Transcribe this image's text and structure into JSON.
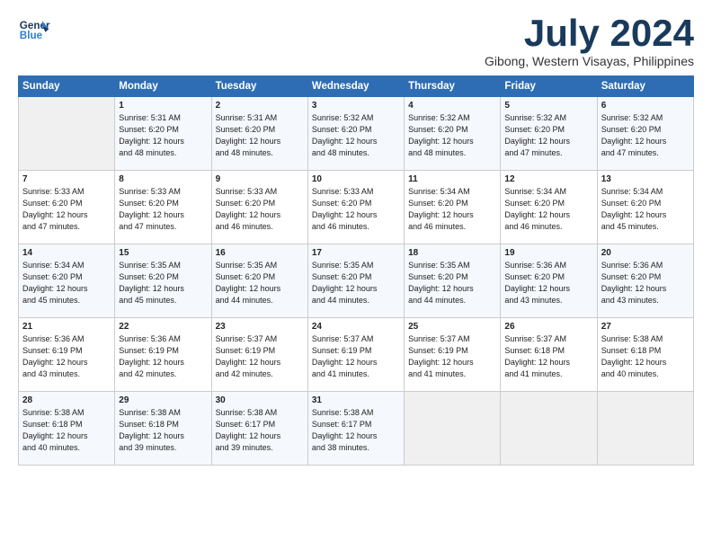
{
  "logo": {
    "line1": "General",
    "line2": "Blue"
  },
  "title": "July 2024",
  "subtitle": "Gibong, Western Visayas, Philippines",
  "days_of_week": [
    "Sunday",
    "Monday",
    "Tuesday",
    "Wednesday",
    "Thursday",
    "Friday",
    "Saturday"
  ],
  "weeks": [
    [
      {
        "day": "",
        "info": ""
      },
      {
        "day": "1",
        "info": "Sunrise: 5:31 AM\nSunset: 6:20 PM\nDaylight: 12 hours\nand 48 minutes."
      },
      {
        "day": "2",
        "info": "Sunrise: 5:31 AM\nSunset: 6:20 PM\nDaylight: 12 hours\nand 48 minutes."
      },
      {
        "day": "3",
        "info": "Sunrise: 5:32 AM\nSunset: 6:20 PM\nDaylight: 12 hours\nand 48 minutes."
      },
      {
        "day": "4",
        "info": "Sunrise: 5:32 AM\nSunset: 6:20 PM\nDaylight: 12 hours\nand 48 minutes."
      },
      {
        "day": "5",
        "info": "Sunrise: 5:32 AM\nSunset: 6:20 PM\nDaylight: 12 hours\nand 47 minutes."
      },
      {
        "day": "6",
        "info": "Sunrise: 5:32 AM\nSunset: 6:20 PM\nDaylight: 12 hours\nand 47 minutes."
      }
    ],
    [
      {
        "day": "7",
        "info": "Sunrise: 5:33 AM\nSunset: 6:20 PM\nDaylight: 12 hours\nand 47 minutes."
      },
      {
        "day": "8",
        "info": "Sunrise: 5:33 AM\nSunset: 6:20 PM\nDaylight: 12 hours\nand 47 minutes."
      },
      {
        "day": "9",
        "info": "Sunrise: 5:33 AM\nSunset: 6:20 PM\nDaylight: 12 hours\nand 46 minutes."
      },
      {
        "day": "10",
        "info": "Sunrise: 5:33 AM\nSunset: 6:20 PM\nDaylight: 12 hours\nand 46 minutes."
      },
      {
        "day": "11",
        "info": "Sunrise: 5:34 AM\nSunset: 6:20 PM\nDaylight: 12 hours\nand 46 minutes."
      },
      {
        "day": "12",
        "info": "Sunrise: 5:34 AM\nSunset: 6:20 PM\nDaylight: 12 hours\nand 46 minutes."
      },
      {
        "day": "13",
        "info": "Sunrise: 5:34 AM\nSunset: 6:20 PM\nDaylight: 12 hours\nand 45 minutes."
      }
    ],
    [
      {
        "day": "14",
        "info": "Sunrise: 5:34 AM\nSunset: 6:20 PM\nDaylight: 12 hours\nand 45 minutes."
      },
      {
        "day": "15",
        "info": "Sunrise: 5:35 AM\nSunset: 6:20 PM\nDaylight: 12 hours\nand 45 minutes."
      },
      {
        "day": "16",
        "info": "Sunrise: 5:35 AM\nSunset: 6:20 PM\nDaylight: 12 hours\nand 44 minutes."
      },
      {
        "day": "17",
        "info": "Sunrise: 5:35 AM\nSunset: 6:20 PM\nDaylight: 12 hours\nand 44 minutes."
      },
      {
        "day": "18",
        "info": "Sunrise: 5:35 AM\nSunset: 6:20 PM\nDaylight: 12 hours\nand 44 minutes."
      },
      {
        "day": "19",
        "info": "Sunrise: 5:36 AM\nSunset: 6:20 PM\nDaylight: 12 hours\nand 43 minutes."
      },
      {
        "day": "20",
        "info": "Sunrise: 5:36 AM\nSunset: 6:20 PM\nDaylight: 12 hours\nand 43 minutes."
      }
    ],
    [
      {
        "day": "21",
        "info": "Sunrise: 5:36 AM\nSunset: 6:19 PM\nDaylight: 12 hours\nand 43 minutes."
      },
      {
        "day": "22",
        "info": "Sunrise: 5:36 AM\nSunset: 6:19 PM\nDaylight: 12 hours\nand 42 minutes."
      },
      {
        "day": "23",
        "info": "Sunrise: 5:37 AM\nSunset: 6:19 PM\nDaylight: 12 hours\nand 42 minutes."
      },
      {
        "day": "24",
        "info": "Sunrise: 5:37 AM\nSunset: 6:19 PM\nDaylight: 12 hours\nand 41 minutes."
      },
      {
        "day": "25",
        "info": "Sunrise: 5:37 AM\nSunset: 6:19 PM\nDaylight: 12 hours\nand 41 minutes."
      },
      {
        "day": "26",
        "info": "Sunrise: 5:37 AM\nSunset: 6:18 PM\nDaylight: 12 hours\nand 41 minutes."
      },
      {
        "day": "27",
        "info": "Sunrise: 5:38 AM\nSunset: 6:18 PM\nDaylight: 12 hours\nand 40 minutes."
      }
    ],
    [
      {
        "day": "28",
        "info": "Sunrise: 5:38 AM\nSunset: 6:18 PM\nDaylight: 12 hours\nand 40 minutes."
      },
      {
        "day": "29",
        "info": "Sunrise: 5:38 AM\nSunset: 6:18 PM\nDaylight: 12 hours\nand 39 minutes."
      },
      {
        "day": "30",
        "info": "Sunrise: 5:38 AM\nSunset: 6:17 PM\nDaylight: 12 hours\nand 39 minutes."
      },
      {
        "day": "31",
        "info": "Sunrise: 5:38 AM\nSunset: 6:17 PM\nDaylight: 12 hours\nand 38 minutes."
      },
      {
        "day": "",
        "info": ""
      },
      {
        "day": "",
        "info": ""
      },
      {
        "day": "",
        "info": ""
      }
    ]
  ]
}
